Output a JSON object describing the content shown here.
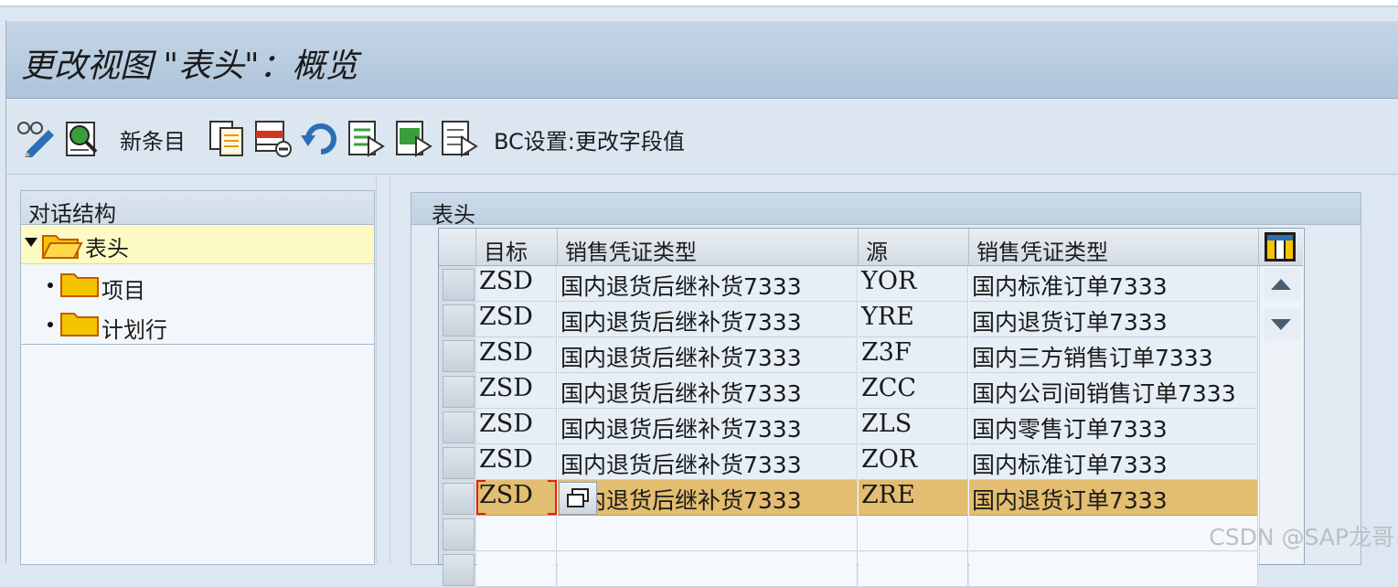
{
  "window": {
    "title": "更改视图 \"表头\"：概览"
  },
  "toolbar": {
    "new_entries_label": "新条目",
    "bc_set_label": "BC设置:更改字段值",
    "icons": [
      "display-change-icon",
      "detail-icon",
      "copy-as-icon",
      "delete-icon",
      "undo-icon",
      "select-all-icon",
      "select-block-icon",
      "deselect-all-icon"
    ]
  },
  "tree": {
    "header": "对话结构",
    "items": [
      {
        "label": "表头",
        "expanded": true,
        "selected": true
      },
      {
        "label": "项目"
      },
      {
        "label": "计划行"
      }
    ]
  },
  "panel": {
    "header": "表头"
  },
  "table": {
    "columns": [
      "目标",
      "销售凭证类型",
      "源",
      "销售凭证类型"
    ],
    "rows": [
      {
        "target": "ZSD",
        "target_desc": "国内退货后继补货7333",
        "source": "YOR",
        "source_desc": "国内标准订单7333"
      },
      {
        "target": "ZSD",
        "target_desc": "国内退货后继补货7333",
        "source": "YRE",
        "source_desc": "国内退货订单7333"
      },
      {
        "target": "ZSD",
        "target_desc": "国内退货后继补货7333",
        "source": "Z3F",
        "source_desc": "国内三方销售订单7333"
      },
      {
        "target": "ZSD",
        "target_desc": "国内退货后继补货7333",
        "source": "ZCC",
        "source_desc": "国内公司间销售订单7333"
      },
      {
        "target": "ZSD",
        "target_desc": "国内退货后继补货7333",
        "source": "ZLS",
        "source_desc": "国内零售订单7333"
      },
      {
        "target": "ZSD",
        "target_desc": "国内退货后继补货7333",
        "source": "ZOR",
        "source_desc": "国内标准订单7333"
      },
      {
        "target": "ZSD",
        "target_desc": "国内退货后继补货7333",
        "source": "ZRE",
        "source_desc": "国内退货订单7333",
        "highlighted": true
      }
    ]
  },
  "watermark": "CSDN @SAP龙哥",
  "colors": {
    "highlight_row": "#e3bd70",
    "selected_tree_row": "#fdfbc3",
    "folder": "#f5c400"
  }
}
